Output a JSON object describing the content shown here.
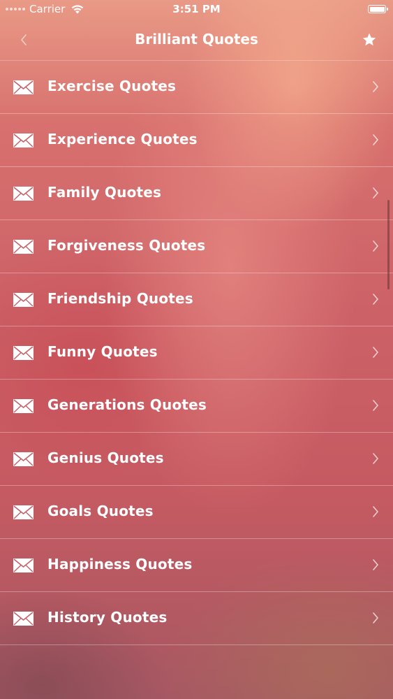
{
  "status_bar": {
    "carrier": "Carrier",
    "time": "3:51 PM"
  },
  "nav": {
    "title": "Brilliant Quotes",
    "back_icon": "chevron-left-icon",
    "favorite_icon": "star-icon"
  },
  "list": {
    "item_icon": "envelope-icon",
    "items": [
      {
        "label": "Exercise Quotes"
      },
      {
        "label": "Experience Quotes"
      },
      {
        "label": "Family Quotes"
      },
      {
        "label": "Forgiveness Quotes"
      },
      {
        "label": "Friendship Quotes"
      },
      {
        "label": "Funny Quotes"
      },
      {
        "label": "Generations Quotes"
      },
      {
        "label": "Genius Quotes"
      },
      {
        "label": "Goals Quotes"
      },
      {
        "label": "Happiness Quotes"
      },
      {
        "label": "History Quotes"
      }
    ]
  },
  "colors": {
    "text": "#ffffff",
    "background_top": "#e99a86",
    "background_mid": "#cc6167",
    "background_bottom": "#a65863"
  }
}
